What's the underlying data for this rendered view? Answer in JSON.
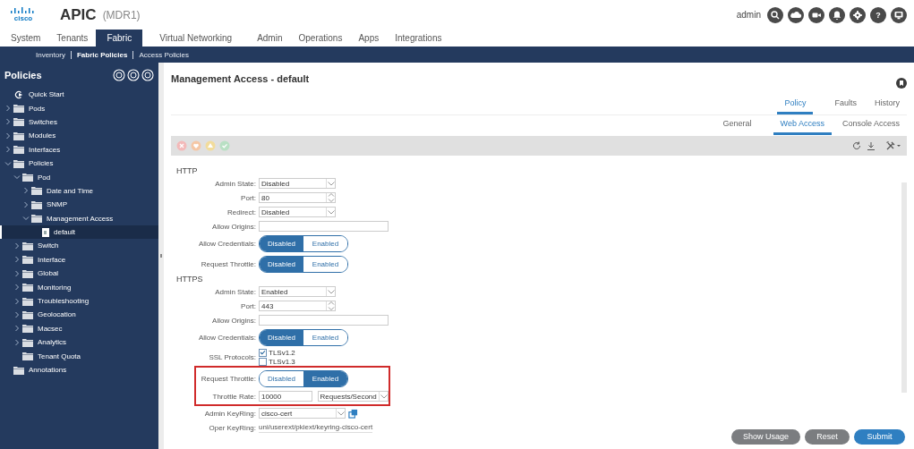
{
  "header": {
    "brand": "cisco",
    "app": "APIC",
    "site": "(MDR1)",
    "user": "admin",
    "icons": [
      {
        "kind": "search"
      },
      {
        "kind": "cloud"
      },
      {
        "kind": "video"
      },
      {
        "kind": "bell"
      },
      {
        "kind": "gear"
      },
      {
        "kind": "help",
        "glyph": "?"
      },
      {
        "kind": "monitor"
      }
    ]
  },
  "tabs": [
    {
      "label": "System",
      "selected": false
    },
    {
      "label": "Tenants",
      "selected": false
    },
    {
      "label": "Fabric",
      "selected": true
    },
    {
      "label": "Virtual Networking",
      "selected": false
    },
    {
      "label": "Admin",
      "selected": false
    },
    {
      "label": "Operations",
      "selected": false
    },
    {
      "label": "Apps",
      "selected": false
    },
    {
      "label": "Integrations",
      "selected": false
    }
  ],
  "subtabs": [
    {
      "label": "Inventory",
      "selected": false
    },
    {
      "label": "Fabric Policies",
      "selected": true
    },
    {
      "label": "Access Policies",
      "selected": false
    }
  ],
  "sidebar": {
    "title": "Policies",
    "items": [
      {
        "label": "Quick Start",
        "kind": "start",
        "selected": false
      },
      {
        "label": "Pods",
        "kind": "folder",
        "expanded": false,
        "selected": false
      },
      {
        "label": "Switches",
        "kind": "folder",
        "expanded": false,
        "selected": false
      },
      {
        "label": "Modules",
        "kind": "folder",
        "expanded": false,
        "selected": false
      },
      {
        "label": "Interfaces",
        "kind": "folder",
        "expanded": false,
        "selected": false
      },
      {
        "label": "Policies",
        "kind": "folder",
        "expanded": true,
        "selected": false,
        "children": [
          {
            "label": "Pod",
            "kind": "folder",
            "expanded": true,
            "selected": false,
            "children": [
              {
                "label": "Date and Time",
                "kind": "folder",
                "expanded": false,
                "selected": false
              },
              {
                "label": "SNMP",
                "kind": "folder",
                "expanded": false,
                "selected": false
              },
              {
                "label": "Management Access",
                "kind": "folder",
                "expanded": true,
                "selected": false,
                "children": [
                  {
                    "label": "default",
                    "kind": "document",
                    "selected": true
                  }
                ]
              }
            ]
          },
          {
            "label": "Switch",
            "kind": "folder",
            "expanded": false,
            "selected": false
          },
          {
            "label": "Interface",
            "kind": "folder",
            "expanded": false,
            "selected": false
          },
          {
            "label": "Global",
            "kind": "folder",
            "expanded": false,
            "selected": false
          },
          {
            "label": "Monitoring",
            "kind": "folder",
            "expanded": false,
            "selected": false
          },
          {
            "label": "Troubleshooting",
            "kind": "folder",
            "expanded": false,
            "selected": false
          },
          {
            "label": "Geolocation",
            "kind": "folder",
            "expanded": false,
            "selected": false
          },
          {
            "label": "Macsec",
            "kind": "folder",
            "expanded": false,
            "selected": false
          },
          {
            "label": "Analytics",
            "kind": "folder",
            "expanded": false,
            "selected": false
          },
          {
            "label": "Tenant Quota",
            "kind": "folder",
            "selected": false
          }
        ]
      },
      {
        "label": "Annotations",
        "kind": "folder",
        "selected": false
      }
    ]
  },
  "panel": {
    "title": "Management Access - default",
    "tabs": [
      {
        "label": "Policy",
        "selected": true
      },
      {
        "label": "Faults",
        "selected": false
      },
      {
        "label": "History",
        "selected": false
      }
    ],
    "subtabs": [
      {
        "label": "General",
        "selected": false
      },
      {
        "label": "Web Access",
        "selected": true
      },
      {
        "label": "Console Access",
        "selected": false
      }
    ],
    "sections": [
      {
        "title": "HTTP",
        "fields": [
          {
            "kind": "select",
            "label": "Admin State:",
            "value": "Disabled"
          },
          {
            "kind": "number",
            "label": "Port:",
            "value": "80"
          },
          {
            "kind": "select",
            "label": "Redirect:",
            "value": "Disabled"
          },
          {
            "kind": "text",
            "label": "Allow Origins:"
          },
          {
            "kind": "toggle",
            "label": "Allow Credentials:",
            "options": [
              {
                "label": "Disabled",
                "selected": true
              },
              {
                "label": "Enabled",
                "selected": false
              }
            ]
          },
          {
            "kind": "toggle",
            "label": "Request Throttle:",
            "options": [
              {
                "label": "Disabled",
                "selected": true
              },
              {
                "label": "Enabled",
                "selected": false
              }
            ]
          }
        ]
      },
      {
        "title": "HTTPS",
        "fields": [
          {
            "kind": "select",
            "label": "Admin State:",
            "value": "Enabled"
          },
          {
            "kind": "number",
            "label": "Port:",
            "value": "443"
          },
          {
            "kind": "text",
            "label": "Allow Origins:"
          },
          {
            "kind": "toggle",
            "label": "Allow Credentials:",
            "options": [
              {
                "label": "Disabled",
                "selected": true
              },
              {
                "label": "Enabled",
                "selected": false
              }
            ]
          },
          {
            "kind": "checks",
            "label": "SSL Protocols:",
            "options": [
              {
                "label": "TLSv1.2",
                "checked": true
              },
              {
                "label": "TLSv1.3",
                "checked": false
              }
            ]
          },
          {
            "kind": "toggle",
            "label": "Request Throttle:",
            "highlighted": true,
            "options": [
              {
                "label": "Disabled",
                "selected": false
              },
              {
                "label": "Enabled",
                "selected": true
              }
            ]
          },
          {
            "kind": "rate",
            "label": "Throttle Rate:",
            "highlighted": true,
            "value": "10000",
            "unit": "Requests/Second"
          },
          {
            "kind": "keyring",
            "label": "Admin KeyRing:",
            "value": "cisco-cert"
          },
          {
            "kind": "readonly",
            "label": "Oper KeyRing:",
            "value": "uni/userext/pkiext/keyring-cisco-cert"
          }
        ]
      }
    ]
  },
  "buttons": [
    {
      "label": "Show Usage",
      "kind": "secondary"
    },
    {
      "label": "Reset",
      "kind": "secondary"
    },
    {
      "label": "Submit",
      "kind": "primary"
    }
  ]
}
